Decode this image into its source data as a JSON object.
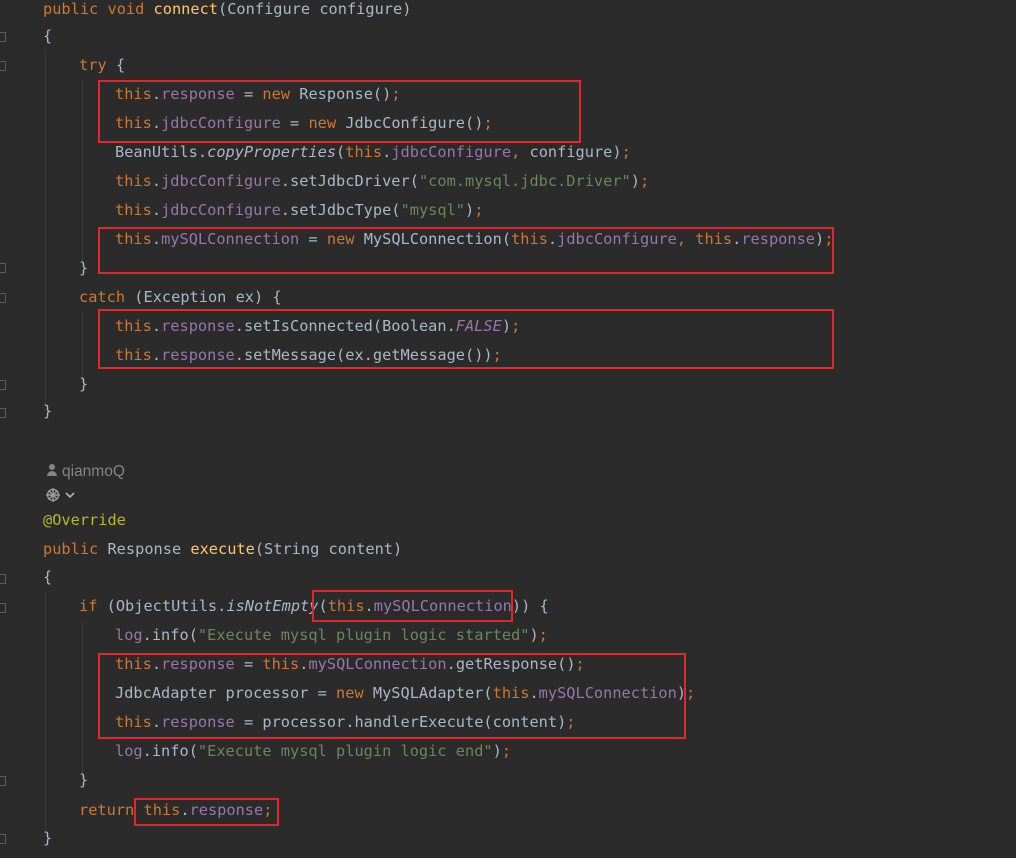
{
  "colors": {
    "background": "#2b2b2b",
    "keyword": "#cc7832",
    "method_declaration": "#ffc66d",
    "field": "#9876aa",
    "string": "#6a8759",
    "annotation": "#bbb529",
    "plain": "#a9b7c6",
    "inlay_hint": "#858585",
    "highlight_box": "#e0272c"
  },
  "inlay_hint": {
    "author": "qianmoQ",
    "icons": [
      "person-icon",
      "generate-icon",
      "chevron-down-icon"
    ]
  },
  "code_lines": [
    {
      "indent": 0,
      "tokens": [
        [
          "kw",
          "public"
        ],
        [
          "pl",
          " "
        ],
        [
          "kw",
          "void"
        ],
        [
          "pl",
          " "
        ],
        [
          "fn",
          "connect"
        ],
        [
          "pl",
          "(Configure configure)"
        ]
      ]
    },
    {
      "indent": 0,
      "tokens": [
        [
          "pl",
          "{"
        ]
      ]
    },
    {
      "indent": 1,
      "tokens": [
        [
          "kw",
          "try"
        ],
        [
          "pl",
          " {"
        ]
      ]
    },
    {
      "indent": 2,
      "tokens": [
        [
          "kw",
          "this"
        ],
        [
          "pl",
          "."
        ],
        [
          "fld",
          "response"
        ],
        [
          "pl",
          " = "
        ],
        [
          "kw",
          "new"
        ],
        [
          "pl",
          " Response()"
        ],
        [
          "punc",
          ";"
        ]
      ]
    },
    {
      "indent": 2,
      "tokens": [
        [
          "kw",
          "this"
        ],
        [
          "pl",
          "."
        ],
        [
          "fld",
          "jdbcConfigure"
        ],
        [
          "pl",
          " = "
        ],
        [
          "kw",
          "new"
        ],
        [
          "pl",
          " JdbcConfigure()"
        ],
        [
          "punc",
          ";"
        ]
      ]
    },
    {
      "indent": 2,
      "tokens": [
        [
          "pl",
          "BeanUtils."
        ],
        [
          "static",
          "copyProperties"
        ],
        [
          "pl",
          "("
        ],
        [
          "kw",
          "this"
        ],
        [
          "pl",
          "."
        ],
        [
          "fld",
          "jdbcConfigure"
        ],
        [
          "punc",
          ", "
        ],
        [
          "pl",
          "configure)"
        ],
        [
          "punc",
          ";"
        ]
      ]
    },
    {
      "indent": 2,
      "tokens": [
        [
          "kw",
          "this"
        ],
        [
          "pl",
          "."
        ],
        [
          "fld",
          "jdbcConfigure"
        ],
        [
          "pl",
          ".setJdbcDriver("
        ],
        [
          "str",
          "\"com.mysql.jdbc.Driver\""
        ],
        [
          "pl",
          ")"
        ],
        [
          "punc",
          ";"
        ]
      ]
    },
    {
      "indent": 2,
      "tokens": [
        [
          "kw",
          "this"
        ],
        [
          "pl",
          "."
        ],
        [
          "fld",
          "jdbcConfigure"
        ],
        [
          "pl",
          ".setJdbcType("
        ],
        [
          "str",
          "\"mysql\""
        ],
        [
          "pl",
          ")"
        ],
        [
          "punc",
          ";"
        ]
      ]
    },
    {
      "indent": 2,
      "tokens": [
        [
          "kw",
          "this"
        ],
        [
          "pl",
          "."
        ],
        [
          "fld",
          "mySQLConnection"
        ],
        [
          "pl",
          " = "
        ],
        [
          "kw",
          "new"
        ],
        [
          "pl",
          " MySQLConnection("
        ],
        [
          "kw",
          "this"
        ],
        [
          "pl",
          "."
        ],
        [
          "fld",
          "jdbcConfigure"
        ],
        [
          "punc",
          ", "
        ],
        [
          "kw",
          "this"
        ],
        [
          "pl",
          "."
        ],
        [
          "fld",
          "response"
        ],
        [
          "pl",
          ")"
        ],
        [
          "punc",
          ";"
        ]
      ]
    },
    {
      "indent": 1,
      "tokens": [
        [
          "pl",
          "}"
        ]
      ]
    },
    {
      "indent": 1,
      "tokens": [
        [
          "kw",
          "catch"
        ],
        [
          "pl",
          " (Exception ex) {"
        ]
      ]
    },
    {
      "indent": 2,
      "tokens": [
        [
          "kw",
          "this"
        ],
        [
          "pl",
          "."
        ],
        [
          "fld",
          "response"
        ],
        [
          "pl",
          ".setIsConnected(Boolean."
        ],
        [
          "const",
          "FALSE"
        ],
        [
          "pl",
          ")"
        ],
        [
          "punc",
          ";"
        ]
      ]
    },
    {
      "indent": 2,
      "tokens": [
        [
          "kw",
          "this"
        ],
        [
          "pl",
          "."
        ],
        [
          "fld",
          "response"
        ],
        [
          "pl",
          ".setMessage(ex.getMessage())"
        ],
        [
          "punc",
          ";"
        ]
      ]
    },
    {
      "indent": 1,
      "tokens": [
        [
          "pl",
          "}"
        ]
      ]
    },
    {
      "indent": 0,
      "tokens": [
        [
          "pl",
          "}"
        ]
      ]
    },
    {
      "indent": 0,
      "tokens": []
    },
    {
      "indent": 0,
      "tokens": [
        [
          "ann",
          "@Override"
        ]
      ]
    },
    {
      "indent": 0,
      "tokens": [
        [
          "kw",
          "public"
        ],
        [
          "pl",
          " Response "
        ],
        [
          "fn",
          "execute"
        ],
        [
          "pl",
          "(String content)"
        ]
      ]
    },
    {
      "indent": 0,
      "tokens": [
        [
          "pl",
          "{"
        ]
      ]
    },
    {
      "indent": 1,
      "tokens": [
        [
          "kw",
          "if"
        ],
        [
          "pl",
          " (ObjectUtils."
        ],
        [
          "static",
          "isNotEmpty"
        ],
        [
          "pl",
          "("
        ],
        [
          "kw",
          "this"
        ],
        [
          "pl",
          "."
        ],
        [
          "fld",
          "mySQLConnection"
        ],
        [
          "pl",
          ")) {"
        ]
      ]
    },
    {
      "indent": 2,
      "tokens": [
        [
          "fld",
          "log"
        ],
        [
          "pl",
          ".info("
        ],
        [
          "str",
          "\"Execute mysql plugin logic started\""
        ],
        [
          "pl",
          ")"
        ],
        [
          "punc",
          ";"
        ]
      ]
    },
    {
      "indent": 2,
      "tokens": [
        [
          "kw",
          "this"
        ],
        [
          "pl",
          "."
        ],
        [
          "fld",
          "response"
        ],
        [
          "pl",
          " = "
        ],
        [
          "kw",
          "this"
        ],
        [
          "pl",
          "."
        ],
        [
          "fld",
          "mySQLConnection"
        ],
        [
          "pl",
          ".getResponse()"
        ],
        [
          "punc",
          ";"
        ]
      ]
    },
    {
      "indent": 2,
      "tokens": [
        [
          "pl",
          "JdbcAdapter processor = "
        ],
        [
          "kw",
          "new"
        ],
        [
          "pl",
          " MySQLAdapter("
        ],
        [
          "kw",
          "this"
        ],
        [
          "pl",
          "."
        ],
        [
          "fld",
          "mySQLConnection"
        ],
        [
          "pl",
          ")"
        ],
        [
          "punc",
          ";"
        ]
      ]
    },
    {
      "indent": 2,
      "tokens": [
        [
          "kw",
          "this"
        ],
        [
          "pl",
          "."
        ],
        [
          "fld",
          "response"
        ],
        [
          "pl",
          " = processor.handlerExecute(content)"
        ],
        [
          "punc",
          ";"
        ]
      ]
    },
    {
      "indent": 2,
      "tokens": [
        [
          "fld",
          "log"
        ],
        [
          "pl",
          ".info("
        ],
        [
          "str",
          "\"Execute mysql plugin logic end\""
        ],
        [
          "pl",
          ")"
        ],
        [
          "punc",
          ";"
        ]
      ]
    },
    {
      "indent": 1,
      "tokens": [
        [
          "pl",
          "}"
        ]
      ]
    },
    {
      "indent": 1,
      "tokens": [
        [
          "kw",
          "return"
        ],
        [
          "pl",
          " "
        ],
        [
          "kw",
          "this"
        ],
        [
          "pl",
          "."
        ],
        [
          "fld",
          "response"
        ],
        [
          "punc",
          ";"
        ]
      ]
    },
    {
      "indent": 0,
      "tokens": [
        [
          "pl",
          "}"
        ]
      ]
    }
  ]
}
